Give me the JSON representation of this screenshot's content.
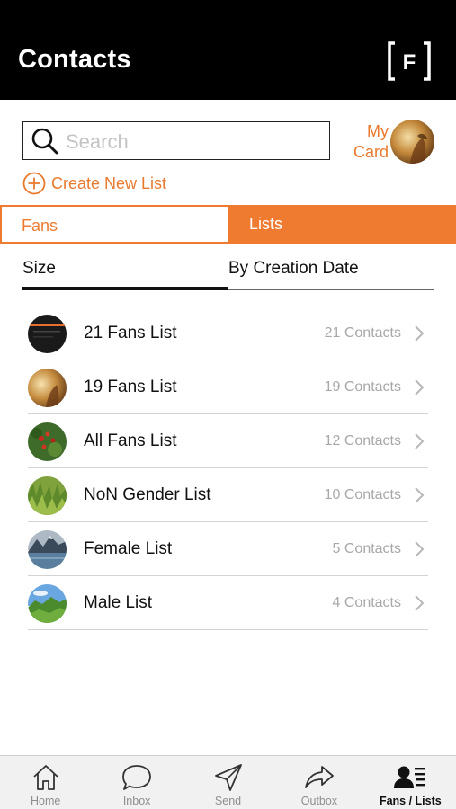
{
  "header": {
    "title": "Contacts",
    "logo": "F"
  },
  "search": {
    "placeholder": "Search"
  },
  "my_card": {
    "label_line1": "My",
    "label_line2": "Card"
  },
  "create_list": {
    "label": "Create New List"
  },
  "segments": {
    "fans": "Fans",
    "lists": "Lists",
    "active": "lists"
  },
  "sort": {
    "size": "Size",
    "creation_date": "By Creation Date",
    "active": "size"
  },
  "lists": [
    {
      "name": "21 Fans List",
      "count": "21 Contacts",
      "thumb": "dark-screen"
    },
    {
      "name": "19 Fans List",
      "count": "19 Contacts",
      "thumb": "golden-portrait"
    },
    {
      "name": "All Fans List",
      "count": "12 Contacts",
      "thumb": "red-berries"
    },
    {
      "name": "NoN Gender List",
      "count": "10 Contacts",
      "thumb": "green-grass"
    },
    {
      "name": "Female List",
      "count": "5 Contacts",
      "thumb": "mountain-lake"
    },
    {
      "name": "Male List",
      "count": "4 Contacts",
      "thumb": "green-hills"
    }
  ],
  "tabbar": [
    {
      "label": "Home",
      "icon": "home-icon"
    },
    {
      "label": "Inbox",
      "icon": "chat-bubble-icon"
    },
    {
      "label": "Send",
      "icon": "paper-plane-icon"
    },
    {
      "label": "Outbox",
      "icon": "share-arrow-icon"
    },
    {
      "label": "Fans / Lists",
      "icon": "contacts-list-icon",
      "active": true
    }
  ],
  "colors": {
    "accent": "#ee7b30",
    "header_bg": "#000000",
    "muted_text": "#a8a8a8"
  }
}
